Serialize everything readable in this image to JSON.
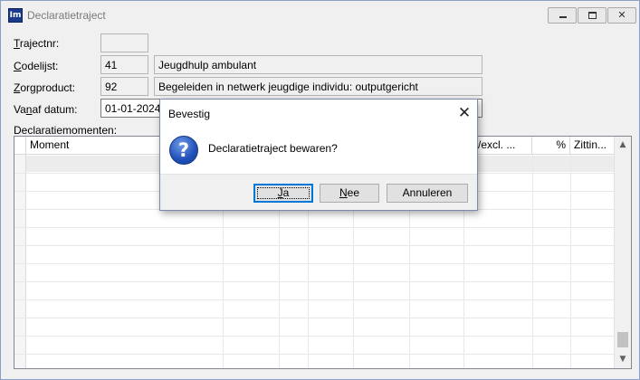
{
  "window": {
    "title": "Declaratietraject",
    "icon_text": "Im",
    "controls": {
      "minimize_icon": "minimize-icon",
      "maximize_icon": "maximize-icon",
      "close_icon": "close-icon",
      "close_glyph": "✕"
    }
  },
  "form": {
    "trajectnr": {
      "label_first": "T",
      "label_rest": "rajectnr:",
      "value": ""
    },
    "codelijst": {
      "label_first": "C",
      "label_rest": "odelijst:",
      "code": "41",
      "description": "Jeugdhulp ambulant"
    },
    "zorgproduct": {
      "label_first": "Z",
      "label_rest": "orgproduct:",
      "code": "92",
      "description": "Begeleiden in netwerk jeugdige individu: outputgericht"
    },
    "vanaf_datum": {
      "label_pre": "Va",
      "label_ul": "n",
      "label_rest": "af datum:",
      "value": "01-01-2024"
    },
    "declaratiemomenten_label": "Declaratiemomenten:"
  },
  "grid": {
    "columns": [
      "Moment",
      "cl./excl. ...",
      "%",
      "Zittin..."
    ],
    "scroll_up": "▲",
    "scroll_down": "▼"
  },
  "dialog": {
    "title": "Bevestig",
    "close_glyph": "✕",
    "icon": "question-icon",
    "icon_glyph": "?",
    "message": "Declaratietraject bewaren?",
    "buttons": {
      "yes": {
        "ul": "J",
        "rest": "a"
      },
      "no": {
        "ul": "N",
        "rest": "ee"
      },
      "cancel": {
        "label": "Annuleren"
      }
    },
    "accent": "#0078d7"
  }
}
